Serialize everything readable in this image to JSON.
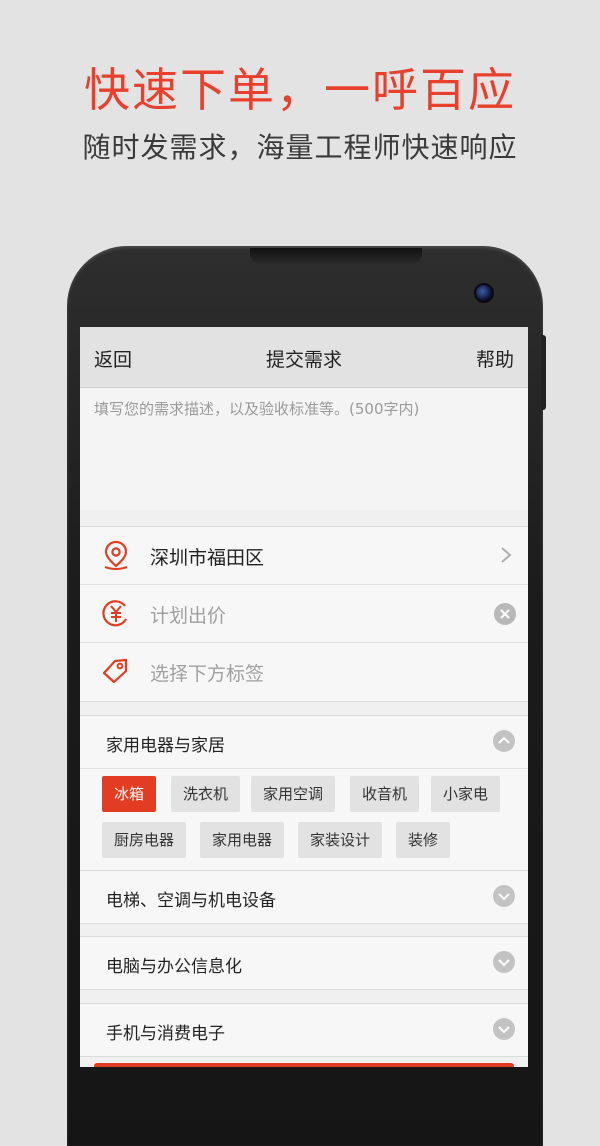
{
  "promo": {
    "title": "快速下单，一呼百应",
    "subtitle": "随时发需求，海量工程师快速响应"
  },
  "navbar": {
    "back_label": "返回",
    "title": "提交需求",
    "help_label": "帮助"
  },
  "description": {
    "placeholder": "填写您的需求描述，以及验收标准等。(500字内)"
  },
  "form": {
    "location": "深圳市福田区",
    "price_placeholder": "计划出价",
    "tag_placeholder": "选择下方标签"
  },
  "categories": [
    {
      "title": "家用电器与家居",
      "expanded": true,
      "tags": [
        "冰箱",
        "洗衣机",
        "家用空调",
        "收音机",
        "小家电",
        "厨房电器",
        "家用电器",
        "家装设计",
        "装修"
      ],
      "selected": "冰箱"
    },
    {
      "title": "电梯、空调与机电设备",
      "expanded": false
    },
    {
      "title": "电脑与办公信息化",
      "expanded": false
    },
    {
      "title": "手机与消费电子",
      "expanded": false
    }
  ],
  "colors": {
    "accent": "#e23c22",
    "promo_title": "#e8402c",
    "background": "#e3e3e3"
  },
  "icons": {
    "location": "location-pin-icon",
    "price": "yen-icon",
    "tag": "tag-icon",
    "chevron": "chevron-right-icon",
    "clear": "clear-icon",
    "collapse": "chevron-up-icon",
    "expand": "chevron-down-icon"
  }
}
